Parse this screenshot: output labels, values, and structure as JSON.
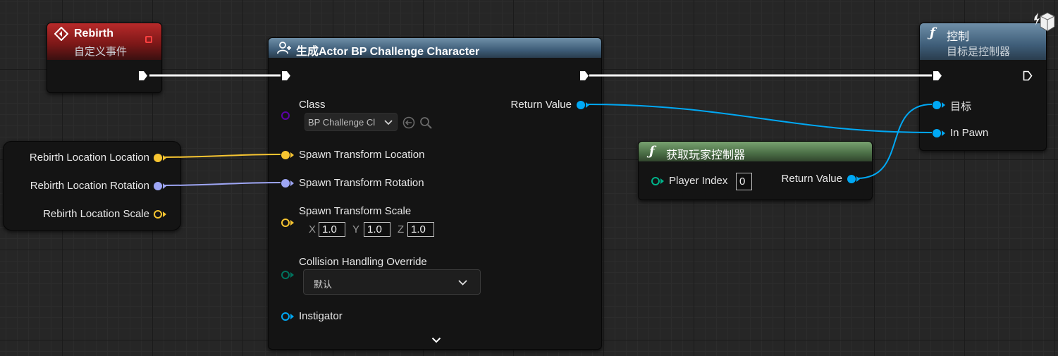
{
  "nodes": {
    "rebirth": {
      "title": "Rebirth",
      "subtitle": "自定义事件"
    },
    "spawn_actor": {
      "title": "生成Actor BP Challenge Character",
      "class_label": "Class",
      "class_value": "BP Challenge Cl",
      "return_value": "Return Value",
      "spawn_location": "Spawn Transform Location",
      "spawn_rotation": "Spawn Transform Rotation",
      "spawn_scale": "Spawn Transform Scale",
      "scale_axes": {
        "x": "X",
        "y": "Y",
        "z": "Z"
      },
      "scale_values": {
        "x": "1.0",
        "y": "1.0",
        "z": "1.0"
      },
      "collision_label": "Collision Handling Override",
      "collision_value": "默认",
      "instigator": "Instigator"
    },
    "rebirth_location": {
      "location": "Rebirth Location Location",
      "rotation": "Rebirth Location Rotation",
      "scale": "Rebirth Location Scale"
    },
    "get_player_controller": {
      "title": "获取玩家控制器",
      "player_index_label": "Player Index",
      "player_index_value": "0",
      "return_value": "Return Value"
    },
    "possess": {
      "title": "控制",
      "subtitle": "目标是控制器",
      "target": "目标",
      "in_pawn": "In Pawn"
    }
  },
  "icons": {
    "event": "event-diamond-icon",
    "spawn": "spawn-actor-icon",
    "function": "function-icon",
    "network": "authority-cube-icon"
  },
  "colors": {
    "exec_wire": "#ffffff",
    "object_pin": "#00a8f4",
    "vector_pin": "#f7c531",
    "rotator_pin": "#9ea6f5",
    "class_pin": "#5c00a8",
    "byte_pin": "#00735e",
    "stop_red": "#ff4040"
  }
}
